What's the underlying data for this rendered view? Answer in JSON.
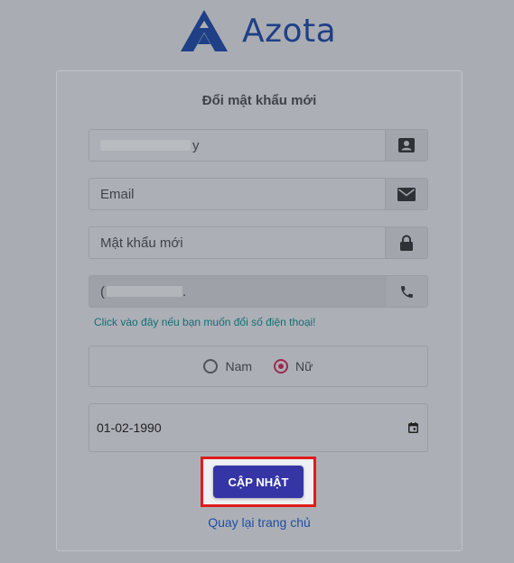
{
  "brand": {
    "name": "Azota"
  },
  "form": {
    "title": "Đổi mật khẩu mới",
    "username": {
      "value": "y"
    },
    "email": {
      "placeholder": "Email"
    },
    "new_password": {
      "placeholder": "Mật khẩu mới"
    },
    "phone": {
      "value": "(",
      "value_end": "."
    },
    "change_phone_link": "Click vào đây nếu bạn muốn đổi số điện thoại!",
    "gender": {
      "options": [
        {
          "label": "Nam",
          "selected": false
        },
        {
          "label": "Nữ",
          "selected": true
        }
      ]
    },
    "birthdate": "01-02-1990",
    "submit_label": "CẬP NHẬT",
    "back_link": "Quay lại trang chủ"
  },
  "icons": {
    "username": "contact-card-icon",
    "email": "envelope-icon",
    "password": "lock-icon",
    "phone": "phone-icon",
    "date": "calendar-icon"
  },
  "colors": {
    "brand": "#1f3f86",
    "button": "#3535a6",
    "link": "#126e75",
    "radio_selected": "#9c2a4e",
    "highlight": "#e11b1b"
  }
}
